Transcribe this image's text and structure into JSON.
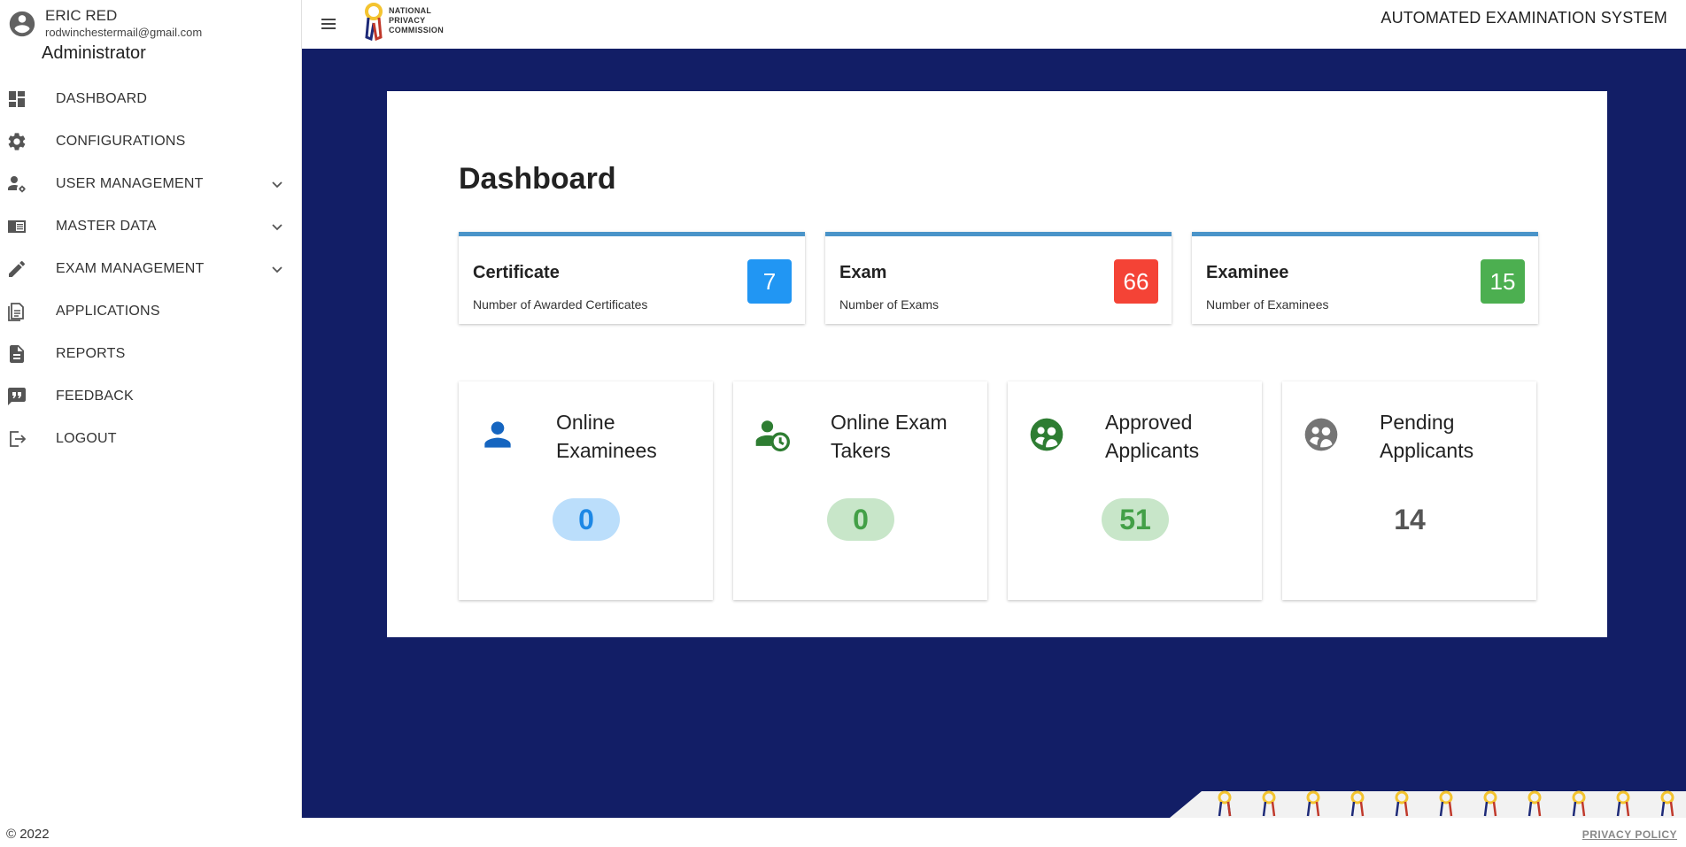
{
  "user": {
    "name": "ERIC RED",
    "email": "rodwinchestermail@gmail.com",
    "role": "Administrator"
  },
  "sidebar": {
    "items": [
      {
        "label": "DASHBOARD",
        "icon": "dashboard-icon",
        "expandable": false
      },
      {
        "label": "CONFIGURATIONS",
        "icon": "gear-icon",
        "expandable": false
      },
      {
        "label": "USER MANAGEMENT",
        "icon": "user-settings-icon",
        "expandable": true
      },
      {
        "label": "MASTER DATA",
        "icon": "book-icon",
        "expandable": true
      },
      {
        "label": "EXAM MANAGEMENT",
        "icon": "pencil-icon",
        "expandable": true
      },
      {
        "label": "APPLICATIONS",
        "icon": "documents-icon",
        "expandable": false
      },
      {
        "label": "REPORTS",
        "icon": "report-icon",
        "expandable": false
      },
      {
        "label": "FEEDBACK",
        "icon": "feedback-icon",
        "expandable": false
      },
      {
        "label": "LOGOUT",
        "icon": "logout-icon",
        "expandable": false
      }
    ],
    "copyright": "© 2022"
  },
  "header": {
    "logo_lines": [
      "NATIONAL",
      "PRIVACY",
      "COMMISSION"
    ],
    "system_title": "AUTOMATED EXAMINATION SYSTEM"
  },
  "main": {
    "page_title": "Dashboard",
    "stats": [
      {
        "title": "Certificate",
        "subtitle": "Number of Awarded Certificates",
        "value": "7",
        "color": "#2196f3"
      },
      {
        "title": "Exam",
        "subtitle": "Number of Exams",
        "value": "66",
        "color": "#f44336"
      },
      {
        "title": "Examinee",
        "subtitle": "Number of Examinees",
        "value": "15",
        "color": "#4caf50"
      }
    ],
    "tiles": [
      {
        "title_line1": "Online",
        "title_line2": "Examinees",
        "value": "0",
        "icon": "person-icon"
      },
      {
        "title_line1": "Online Exam",
        "title_line2": "Takers",
        "value": "0",
        "icon": "person-clock-icon"
      },
      {
        "title_line1": "Approved",
        "title_line2": "Applicants",
        "value": "51",
        "icon": "group-approved-icon"
      },
      {
        "title_line1": "Pending",
        "title_line2": "Applicants",
        "value": "14",
        "icon": "group-pending-icon"
      }
    ]
  },
  "footer": {
    "privacy_policy": "PRIVACY POLICY"
  },
  "colors": {
    "main_background": "#121e66",
    "stat_border": "#4a94c9"
  }
}
